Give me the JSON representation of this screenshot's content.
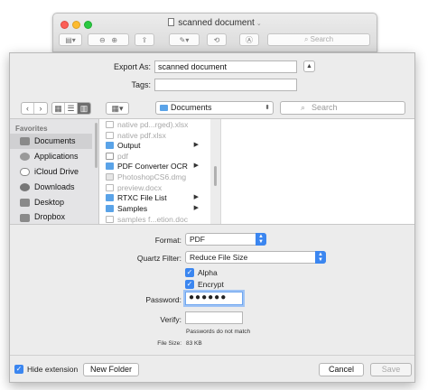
{
  "preview_window": {
    "title": "scanned document",
    "search_placeholder": "Search"
  },
  "export": {
    "export_as_label": "Export As:",
    "export_as_value": "scanned document",
    "tags_label": "Tags:",
    "tags_value": ""
  },
  "browser": {
    "location": "Documents",
    "search_placeholder": "Search",
    "sidebar_heading": "Favorites",
    "sidebar_items": [
      {
        "label": "Documents",
        "icon": "documents-folder-icon",
        "selected": true
      },
      {
        "label": "Applications",
        "icon": "applications-icon",
        "selected": false
      },
      {
        "label": "iCloud Drive",
        "icon": "icloud-icon",
        "selected": false
      },
      {
        "label": "Downloads",
        "icon": "downloads-icon",
        "selected": false
      },
      {
        "label": "Desktop",
        "icon": "desktop-icon",
        "selected": false
      },
      {
        "label": "Dropbox",
        "icon": "dropbox-icon",
        "selected": false
      }
    ],
    "files": [
      {
        "name": "native pd...rged).xlsx",
        "kind": "file",
        "enabled": false
      },
      {
        "name": "native pdf.xlsx",
        "kind": "file",
        "enabled": false
      },
      {
        "name": "Output",
        "kind": "folder",
        "enabled": true
      },
      {
        "name": "pdf",
        "kind": "file",
        "enabled": false
      },
      {
        "name": "PDF Converter OCR",
        "kind": "folder",
        "enabled": true
      },
      {
        "name": "PhotoshopCS6.dmg",
        "kind": "file",
        "enabled": false
      },
      {
        "name": "preview.docx",
        "kind": "file",
        "enabled": false
      },
      {
        "name": "RTXC File List",
        "kind": "folder",
        "enabled": true
      },
      {
        "name": "Samples",
        "kind": "folder",
        "enabled": true
      },
      {
        "name": "samples f...etion.doc",
        "kind": "file",
        "enabled": false
      }
    ]
  },
  "options": {
    "format_label": "Format:",
    "format_value": "PDF",
    "quartz_label": "Quartz Filter:",
    "quartz_value": "Reduce File Size",
    "alpha_label": "Alpha",
    "encrypt_label": "Encrypt",
    "password_label": "Password:",
    "password_value": "●●●●●●",
    "verify_label": "Verify:",
    "verify_value": "",
    "mismatch_text": "Passwords do not match",
    "file_size_label": "File Size:",
    "file_size_value": "83 KB"
  },
  "footer": {
    "hide_extension_label": "Hide extension",
    "new_folder_label": "New Folder",
    "cancel_label": "Cancel",
    "save_label": "Save"
  },
  "colors": {
    "accent": "#3b86f0",
    "folder": "#5aa3e8"
  }
}
